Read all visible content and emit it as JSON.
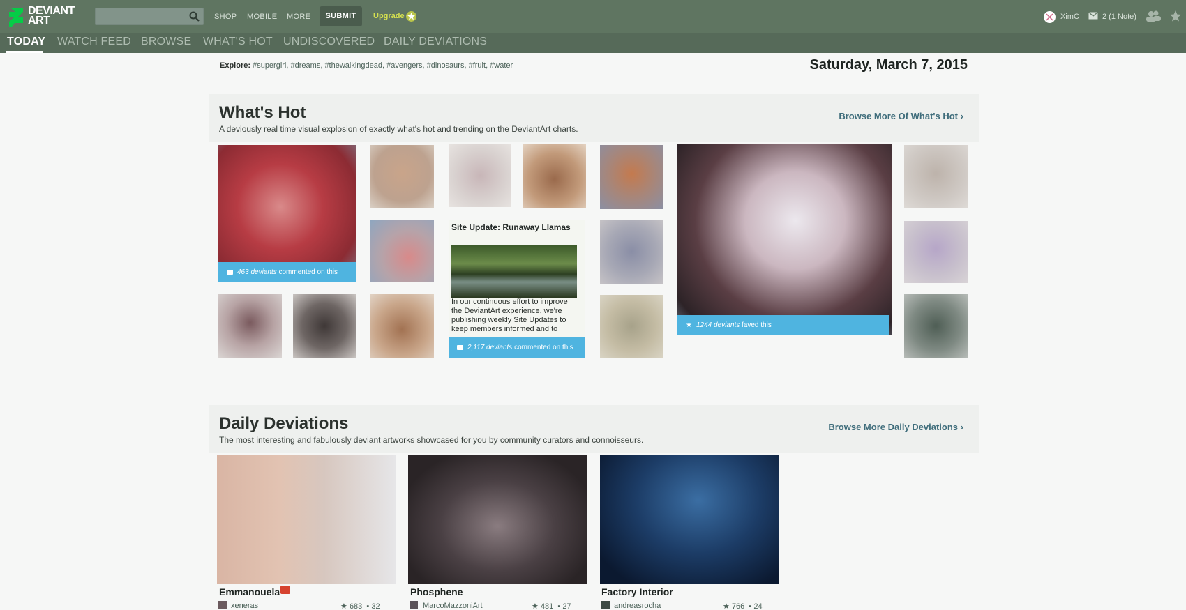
{
  "header": {
    "logo_line1": "DEVIANT",
    "logo_line2": "ART",
    "search_value": "",
    "nav": [
      "SHOP",
      "MOBILE",
      "MORE"
    ],
    "submit_label": "SUBMIT",
    "upgrade_label": "Upgrade",
    "username": "XimC",
    "notes_label": "2 (1 Note)"
  },
  "tabs": [
    "TODAY",
    "WATCH FEED",
    "BROWSE",
    "WHAT'S HOT",
    "UNDISCOVERED",
    "DAILY DEVIATIONS"
  ],
  "explore": {
    "label": "Explore:",
    "tags": [
      "#supergirl",
      "#dreams",
      "#thewalkingdead",
      "#avengers",
      "#dinosaurs",
      "#fruit",
      "#water"
    ]
  },
  "date": "Saturday, March 7, 2015",
  "whats_hot": {
    "title": "What's Hot",
    "subtitle": "A deviously real time visual explosion of exactly what's hot and trending on the DeviantArt charts.",
    "link": "Browse More Of What's Hot",
    "stat1_count": "463 deviants",
    "stat1_text": "commented on this",
    "stat2_count": "2,117 deviants",
    "stat2_text": "commented on this",
    "stat3_count": "1244 deviants",
    "stat3_text": "faved this",
    "news_title": "Site Update: Runaway Llamas",
    "news_body": "In our continuous effort to improve the DeviantArt experience, we're publishing weekly Site Updates to keep members informed and to gather"
  },
  "daily": {
    "title": "Daily Deviations",
    "subtitle": "The most interesting and fabulously deviant artworks showcased for you by community curators and connoisseurs.",
    "link": "Browse More Daily Deviations",
    "cards": [
      {
        "title": "Emmanouela",
        "author": "xeneras",
        "favs": "683",
        "comments": "32"
      },
      {
        "title": "Phosphene",
        "author": "MarcoMazzoniArt",
        "favs": "481",
        "comments": "27"
      },
      {
        "title": "Factory Interior",
        "author": "andreasrocha",
        "favs": "766",
        "comments": "24"
      }
    ]
  },
  "colors": {
    "topbar": "#5f7561",
    "subnav": "#566a59",
    "stat_bar": "#4fb4e0",
    "link": "#3f6d7b"
  }
}
